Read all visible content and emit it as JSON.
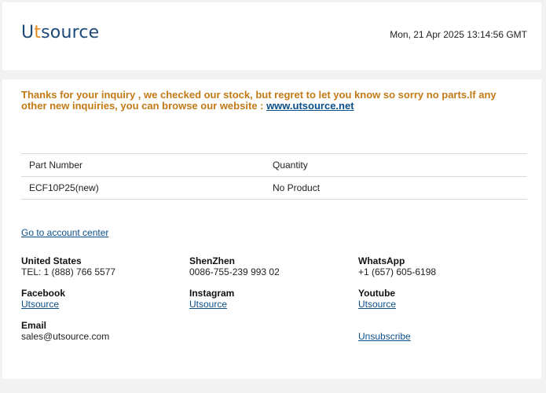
{
  "header": {
    "logo_u": "U",
    "logo_t": "t",
    "logo_rest": "source",
    "date": "Mon, 21 Apr 2025 13:14:56 GMT"
  },
  "notice": {
    "text": "Thanks for your inquiry , we checked our stock, but regret to let you know so sorry no parts.If any other new inquiries, you can browse our website : ",
    "link": "www.utsource.net"
  },
  "table": {
    "headers": [
      "Part Number",
      "Quantity"
    ],
    "rows": [
      [
        "ECF10P25(new)",
        "No Product"
      ]
    ]
  },
  "account_link": "Go to account center",
  "contacts": {
    "united_states": {
      "label": "United States",
      "value": "TEL: 1 (888) 766 5577"
    },
    "shenzhen": {
      "label": "ShenZhen",
      "value": "0086-755-239 993 02"
    },
    "whatsapp": {
      "label": "WhatsApp",
      "value": "+1 (657) 605-6198"
    },
    "facebook": {
      "label": "Facebook",
      "link": "Utsource"
    },
    "instagram": {
      "label": "Instagram",
      "link": "Utsource"
    },
    "youtube": {
      "label": "Youtube",
      "link": "Utsource"
    },
    "email": {
      "label": "Email",
      "value": "sales@utsource.com"
    },
    "unsubscribe": "Unsubscribe"
  },
  "colors": {
    "notice": "#c27a16",
    "link": "#0b4f8a",
    "logo_primary": "#1e4a7a",
    "logo_accent": "#e08a1e"
  }
}
